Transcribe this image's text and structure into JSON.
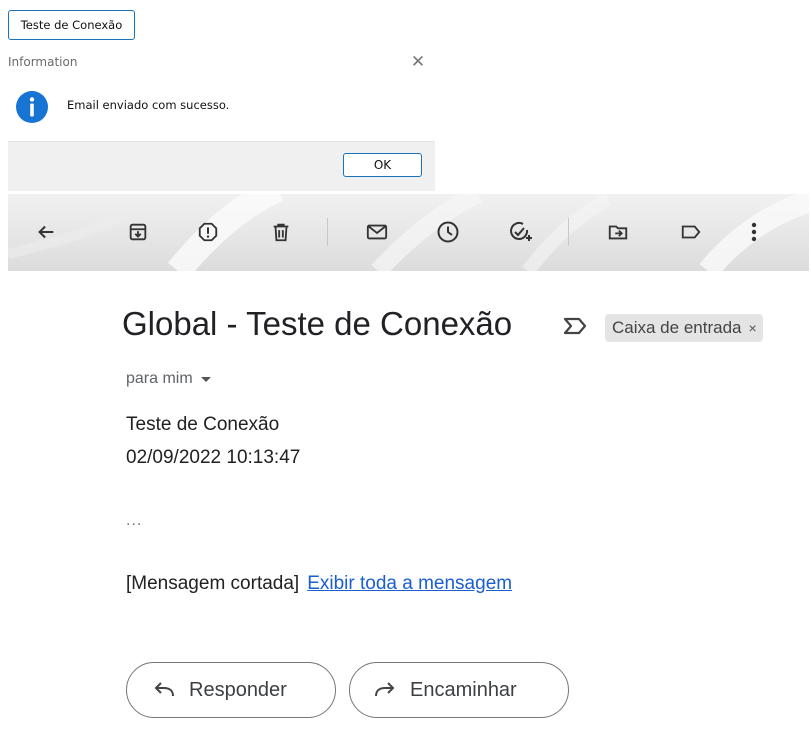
{
  "test_button": {
    "label": "Teste de Conexão"
  },
  "dialog": {
    "title": "Information",
    "icon": "info-icon",
    "message": "Email enviado com sucesso.",
    "ok_label": "OK",
    "accent": "#1a73b8"
  },
  "toolbar": {
    "icons": [
      "back-arrow-icon",
      "archive-icon",
      "report-spam-icon",
      "delete-icon",
      "mark-unread-icon",
      "snooze-icon",
      "add-to-tasks-icon",
      "move-to-icon",
      "labels-icon",
      "more-options-icon"
    ]
  },
  "email": {
    "subject": "Global - Teste de Conexão",
    "label_chip": "Caixa de entrada",
    "label_remove": "×",
    "recipient": "para mim",
    "body_line1": "Teste de Conexão",
    "body_line2": "02/09/2022 10:13:47",
    "ellipsis": "...",
    "clipped_text": "[Mensagem cortada]",
    "view_full_link": "Exibir toda a mensagem",
    "reply_label": "Responder",
    "forward_label": "Encaminhar",
    "link_color": "#1a5fd0"
  }
}
